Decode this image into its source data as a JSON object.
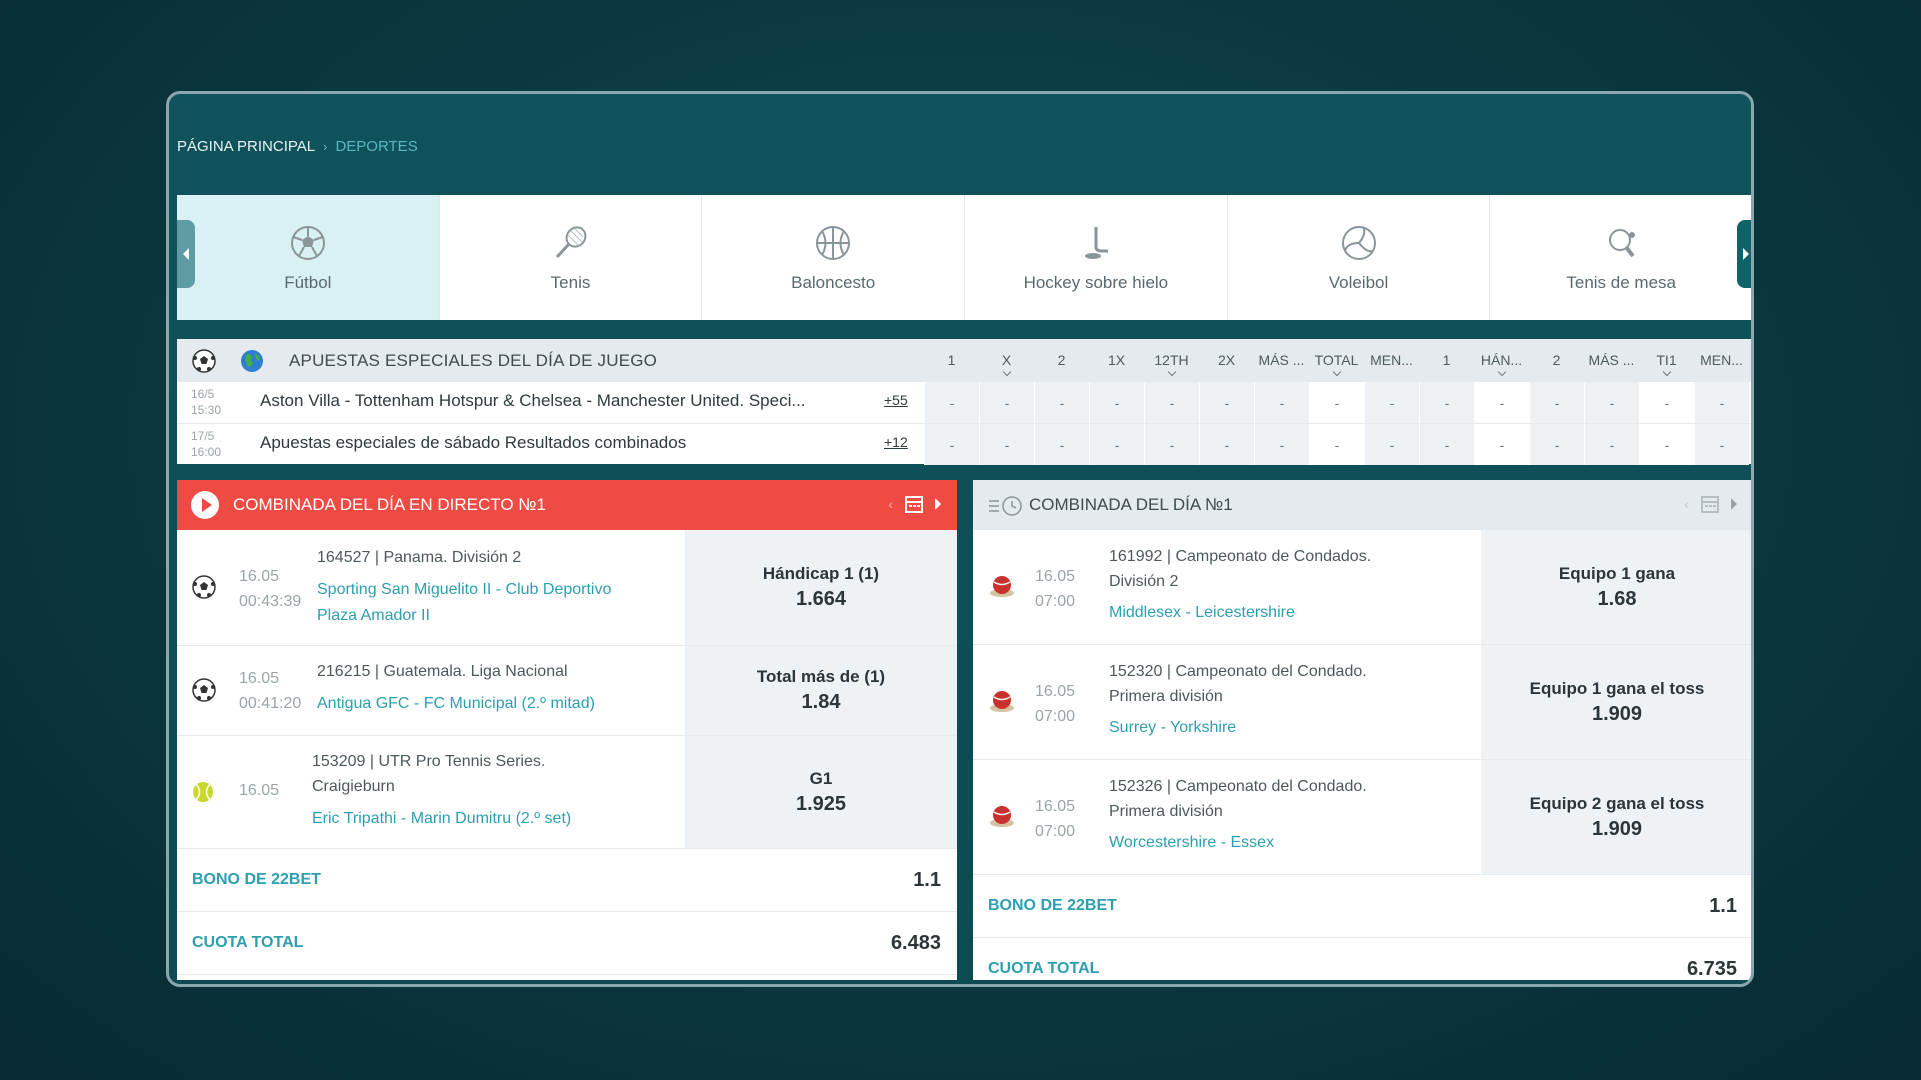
{
  "breadcrumb": {
    "home": "PÁGINA PRINCIPAL",
    "current": "DEPORTES"
  },
  "sports": [
    "Fútbol",
    "Tenis",
    "Baloncesto",
    "Hockey sobre hielo",
    "Voleibol",
    "Tenis de mesa"
  ],
  "specials": {
    "title": "APUESTAS ESPECIALES DEL DÍA DE JUEGO",
    "columns": [
      "1",
      "X",
      "2",
      "1X",
      "12TH",
      "2X",
      "MÁS ...",
      "TOTAL",
      "MEN...",
      "1",
      "HÁN...",
      "2",
      "MÁS ...",
      "TI1",
      "MEN..."
    ],
    "rows": [
      {
        "date": "16/5",
        "time": "15:30",
        "name": "Aston Villa - Tottenham Hotspur & Chelsea - Manchester United. Speci...",
        "more": "+55"
      },
      {
        "date": "17/5",
        "time": "16:00",
        "name": "Apuestas especiales de sábado Resultados combinados",
        "more": "+12"
      }
    ],
    "dash": "-"
  },
  "live_combo": {
    "title": "COMBINADA DEL DÍA EN DIRECTO №1",
    "events": [
      {
        "date": "16.05",
        "time": "00:43:39",
        "league": "164527 | Panama. División 2",
        "teams": "Sporting San Miguelito II  - Club Deportivo",
        "teams2": "Plaza Amador II",
        "bet": "Hándicap 1 (1)",
        "odd": "1.664"
      },
      {
        "date": "16.05",
        "time": "00:41:20",
        "league": "216215 | Guatemala. Liga Nacional",
        "teams": "Antigua GFC  - FC Municipal (2.º mitad)",
        "bet": "Total más de (1)",
        "odd": "1.84"
      },
      {
        "date": "16.05",
        "league": "153209 | UTR Pro Tennis Series.",
        "league2": "Craigieburn",
        "teams": "Eric Tripathi  - Marin Dumitru (2.º set)",
        "bet": "G1",
        "odd": "1.925"
      }
    ],
    "bonus_label": "BONO DE 22BET",
    "bonus": "1.1",
    "total_label": "CUOTA TOTAL",
    "total": "6.483"
  },
  "day_combo": {
    "title": "COMBINADA DEL DÍA №1",
    "events": [
      {
        "date": "16.05",
        "time": "07:00",
        "league": "161992 | Campeonato de Condados.",
        "league2": "División 2",
        "teams": "Middlesex  - Leicestershire",
        "bet": "Equipo 1 gana",
        "odd": "1.68"
      },
      {
        "date": "16.05",
        "time": "07:00",
        "league": "152320 | Campeonato del Condado.",
        "league2": "Primera división",
        "teams": "Surrey  - Yorkshire",
        "bet": "Equipo 1 gana el toss",
        "odd": "1.909"
      },
      {
        "date": "16.05",
        "time": "07:00",
        "league": "152326 | Campeonato del Condado.",
        "league2": "Primera división",
        "teams": "Worcestershire  - Essex",
        "bet": "Equipo 2 gana el toss",
        "odd": "1.909"
      }
    ],
    "bonus_label": "BONO DE 22BET",
    "bonus": "1.1",
    "total_label": "CUOTA TOTAL",
    "total": "6.735"
  },
  "colors": {
    "accent": "#2c9fb0",
    "live": "#ef4b44",
    "active_sport": "#d8f1f3"
  }
}
